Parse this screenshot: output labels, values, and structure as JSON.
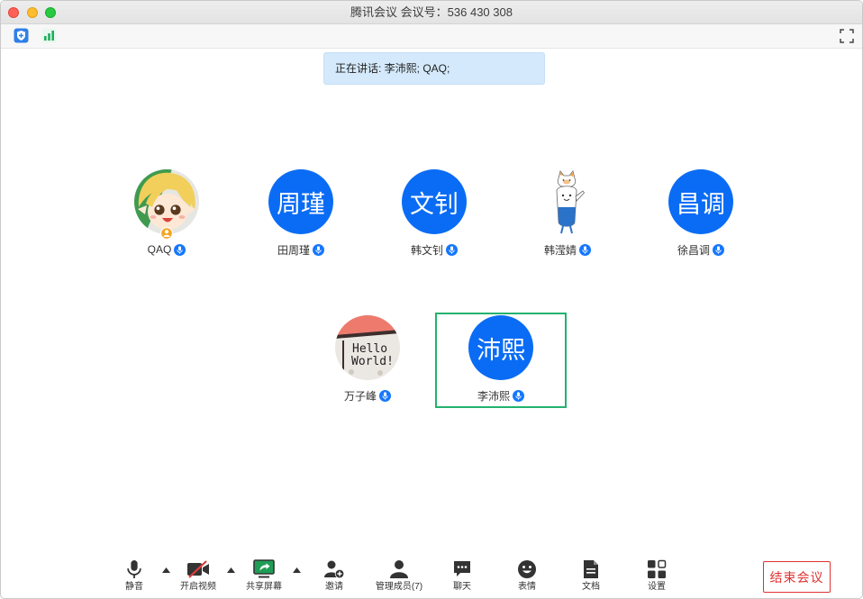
{
  "window": {
    "title": "腾讯会议 会议号：536 430 308",
    "controls": [
      "close-window-icon",
      "minimize-window-icon",
      "zoom-window-icon"
    ]
  },
  "top_bar": {
    "left_icons": [
      "security-shield-icon",
      "signal-strength-icon"
    ],
    "right_icon": "fullscreen-icon"
  },
  "speaking_banner": {
    "text": "正在讲话: 李沛熙; QAQ;"
  },
  "participants": [
    {
      "name": "QAQ",
      "avatar_icon": "anime-character-avatar-icon",
      "host": true,
      "mic_icon": "microphone-on-icon"
    },
    {
      "name": "田周瑾",
      "avatar_text": "周瑾",
      "mic_icon": "microphone-on-icon"
    },
    {
      "name": "韩文钊",
      "avatar_text": "文钊",
      "mic_icon": "microphone-on-icon"
    },
    {
      "name": "韩滢婧",
      "avatar_icon": "cartoon-character-avatar-icon",
      "mic_icon": "microphone-on-icon"
    },
    {
      "name": "徐昌调",
      "avatar_text": "昌调",
      "mic_icon": "microphone-on-icon"
    },
    {
      "name": "万子峰",
      "avatar_icon": "photo-avatar-icon",
      "avatar_photo_text": [
        "Hello",
        "World!"
      ],
      "mic_icon": "microphone-on-icon"
    },
    {
      "name": "李沛熙",
      "avatar_text": "沛熙",
      "active_speaker": true,
      "mic_icon": "microphone-on-icon"
    }
  ],
  "toolbar": {
    "items": [
      {
        "label": "静音",
        "icon": "microphone-icon",
        "has_menu": true
      },
      {
        "label": "开启视频",
        "icon": "video-off-icon",
        "has_menu": true
      },
      {
        "label": "共享屏幕",
        "icon": "share-screen-icon",
        "has_menu": true
      },
      {
        "label": "邀请",
        "icon": "invite-user-icon"
      },
      {
        "label": "管理成员(7)",
        "icon": "members-icon"
      },
      {
        "label": "聊天",
        "icon": "chat-icon"
      },
      {
        "label": "表情",
        "icon": "emoji-icon"
      },
      {
        "label": "文档",
        "icon": "document-icon"
      },
      {
        "label": "设置",
        "icon": "settings-icon"
      }
    ],
    "menu_caret_icon": "caret-up-icon",
    "end_meeting_label": "结束会议"
  },
  "colors": {
    "accent_blue": "#0a6cf5",
    "active_speaker_border": "#23b26d",
    "end_meeting_red": "#e03131",
    "banner_background": "#d4e9fb",
    "mic_badge_blue": "#1677ff",
    "share_green": "#1f9d55",
    "video_off_red": "#e03c3c",
    "host_badge_orange": "#f5a524"
  }
}
